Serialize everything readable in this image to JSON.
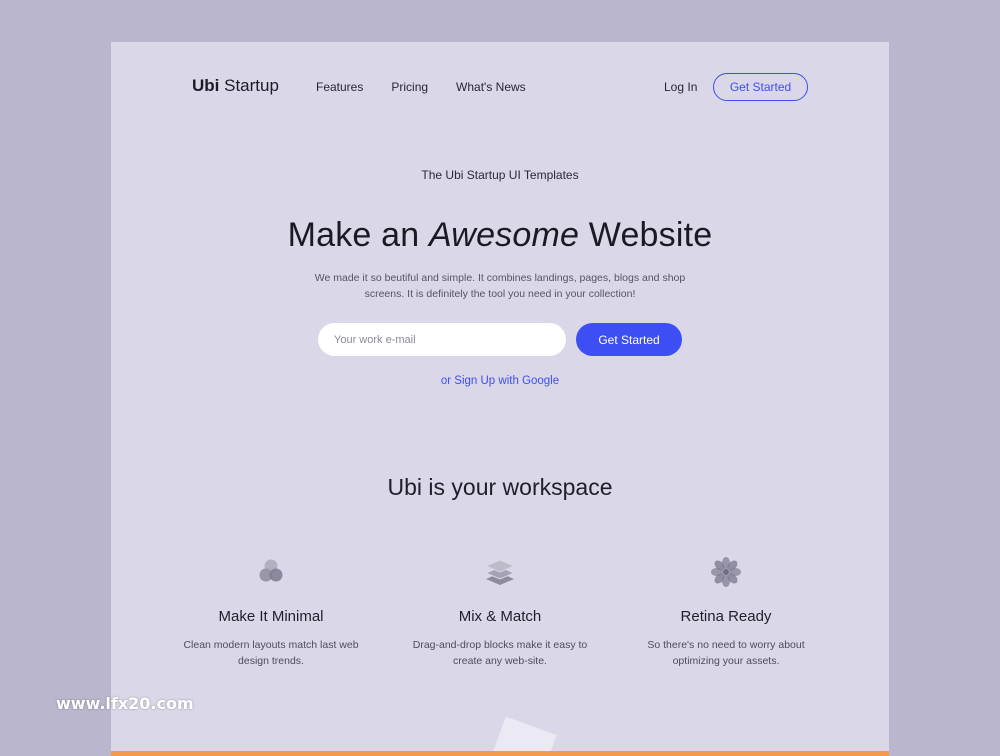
{
  "header": {
    "brand_bold": "Ubi",
    "brand_rest": " Startup",
    "nav": [
      {
        "label": "Features"
      },
      {
        "label": "Pricing"
      },
      {
        "label": "What's News"
      }
    ],
    "login_label": "Log In",
    "cta_label": "Get Started"
  },
  "hero": {
    "eyebrow": "The Ubi Startup UI Templates",
    "title_pre": "Make an ",
    "title_em": "Awesome",
    "title_post": " Website",
    "subtitle": "We made it so beutiful and simple. It combines landings, pages, blogs and shop screens. It is definitely the tool you need in your collection!",
    "email_placeholder": "Your work e-mail",
    "email_value": "",
    "cta_label": "Get Started",
    "google_link": "or Sign Up with Google"
  },
  "features": {
    "title": "Ubi is your workspace",
    "items": [
      {
        "icon": "circles-icon",
        "title": "Make It Minimal",
        "desc": "Clean modern layouts match last web design trends."
      },
      {
        "icon": "layers-icon",
        "title": "Mix & Match",
        "desc": "Drag-and-drop blocks make it easy to create any web-site."
      },
      {
        "icon": "flower-icon",
        "title": "Retina Ready",
        "desc": "So there's no need to worry about optimizing your assets."
      }
    ]
  },
  "watermark": "www.lfx20.com",
  "colors": {
    "accent": "#3d4ef5",
    "page_bg": "#dad7e8",
    "outer_bg": "#bab6cd",
    "bottom_bar": "#f39a4e"
  }
}
